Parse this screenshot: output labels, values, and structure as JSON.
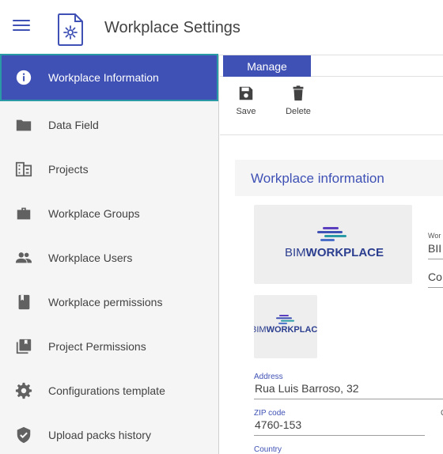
{
  "header": {
    "title": "Workplace Settings"
  },
  "sidebar": {
    "items": [
      {
        "label": "Workplace Information",
        "icon": "info-icon",
        "active": true
      },
      {
        "label": "Data Field",
        "icon": "folder-icon"
      },
      {
        "label": "Projects",
        "icon": "building-icon"
      },
      {
        "label": "Workplace Groups",
        "icon": "briefcase-icon"
      },
      {
        "label": "Workplace Users",
        "icon": "people-icon"
      },
      {
        "label": "Workplace permissions",
        "icon": "book-icon"
      },
      {
        "label": "Project Permissions",
        "icon": "library-icon"
      },
      {
        "label": "Configurations template",
        "icon": "gear-icon"
      },
      {
        "label": "Upload packs history",
        "icon": "shield-check-icon"
      }
    ]
  },
  "main": {
    "tab": "Manage",
    "toolbar": {
      "save_label": "Save",
      "delete_label": "Delete"
    },
    "section_title": "Workplace information",
    "logo": {
      "text_light": "BIM",
      "text_bold": "WORKPLACE"
    },
    "logo_small": {
      "text_light": "BIM",
      "text_bold": "WORKPLACE"
    },
    "side_field": {
      "label": "Wor",
      "value": "BII",
      "second": "Co"
    },
    "address": {
      "label": "Address",
      "value": "Rua Luis Barroso, 32"
    },
    "zip": {
      "label": "ZIP code",
      "value": "4760-153"
    },
    "country": {
      "label": "Country"
    },
    "cut_field": {
      "label": "C"
    }
  },
  "colors": {
    "primary": "#3f51b5",
    "active_outline": "#2a9aa6",
    "sidebar_bg": "#f5f5f5"
  }
}
